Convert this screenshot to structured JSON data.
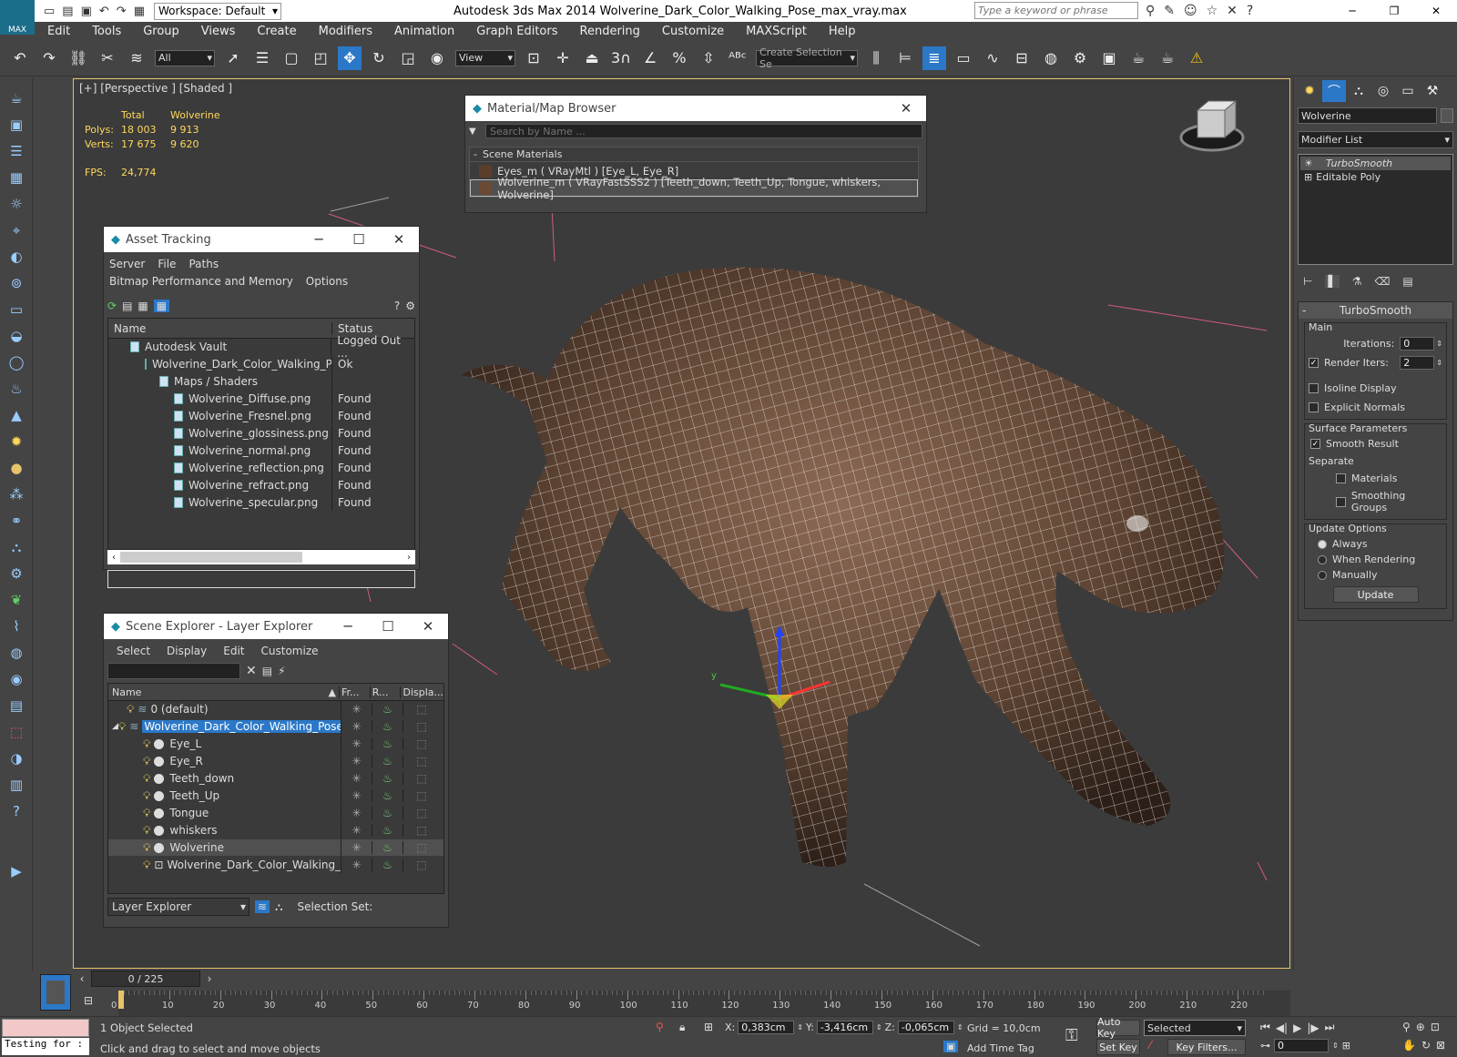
{
  "app": {
    "title": "Autodesk 3ds Max  2014    Wolverine_Dark_Color_Walking_Pose_max_vray.max",
    "logo": "MAX",
    "workspace": "Workspace: Default",
    "search_placeholder": "Type a keyword or phrase"
  },
  "menu": [
    "Edit",
    "Tools",
    "Group",
    "Views",
    "Create",
    "Modifiers",
    "Animation",
    "Graph Editors",
    "Rendering",
    "Customize",
    "MAXScript",
    "Help"
  ],
  "toolbar": {
    "filter": "All",
    "view": "View",
    "snap_label": "3",
    "create_selection": "Create Selection Se"
  },
  "viewport": {
    "label": "[+] [Perspective ] [Shaded ]",
    "stats": {
      "col_total": "Total",
      "col_object": "Wolverine",
      "polys_label": "Polys:",
      "polys_total": "18 003",
      "polys_obj": "9 913",
      "verts_label": "Verts:",
      "verts_total": "17 675",
      "verts_obj": "9 620",
      "fps_label": "FPS:",
      "fps": "24,774"
    }
  },
  "material_browser": {
    "title": "Material/Map Browser",
    "search_placeholder": "Search by Name ...",
    "group": "Scene Materials",
    "items": [
      "Eyes_m  ( VRayMtl )  [Eye_L, Eye_R]",
      "Wolverine_m  ( VRayFastSSS2 )  [Teeth_down, Teeth_Up, Tongue, whiskers, Wolverine]"
    ]
  },
  "asset_tracking": {
    "title": "Asset Tracking",
    "menu": [
      "Server",
      "File",
      "Paths",
      "Bitmap Performance and Memory",
      "Options"
    ],
    "col_name": "Name",
    "col_status": "Status",
    "rows": [
      {
        "name": "Autodesk Vault",
        "status": "Logged Out ..."
      },
      {
        "name": "Wolverine_Dark_Color_Walking_Po...",
        "status": "Ok"
      },
      {
        "name": "Maps / Shaders",
        "status": ""
      },
      {
        "name": "Wolverine_Diffuse.png",
        "status": "Found"
      },
      {
        "name": "Wolverine_Fresnel.png",
        "status": "Found"
      },
      {
        "name": "Wolverine_glossiness.png",
        "status": "Found"
      },
      {
        "name": "Wolverine_normal.png",
        "status": "Found"
      },
      {
        "name": "Wolverine_reflection.png",
        "status": "Found"
      },
      {
        "name": "Wolverine_refract.png",
        "status": "Found"
      },
      {
        "name": "Wolverine_specular.png",
        "status": "Found"
      }
    ]
  },
  "scene_explorer": {
    "title": "Scene Explorer - Layer Explorer",
    "menu": [
      "Select",
      "Display",
      "Edit",
      "Customize"
    ],
    "columns": [
      "Name",
      "Fr...",
      "R...",
      "Displa..."
    ],
    "rows": [
      {
        "name": "0 (default)",
        "indent": 0,
        "type": "layer"
      },
      {
        "name": "Wolverine_Dark_Color_Walking_Pose",
        "indent": 0,
        "type": "layer",
        "selected": true
      },
      {
        "name": "Eye_L",
        "indent": 1,
        "type": "obj"
      },
      {
        "name": "Eye_R",
        "indent": 1,
        "type": "obj"
      },
      {
        "name": "Teeth_down",
        "indent": 1,
        "type": "obj"
      },
      {
        "name": "Teeth_Up",
        "indent": 1,
        "type": "obj"
      },
      {
        "name": "Tongue",
        "indent": 1,
        "type": "obj"
      },
      {
        "name": "whiskers",
        "indent": 1,
        "type": "obj"
      },
      {
        "name": "Wolverine",
        "indent": 1,
        "type": "obj",
        "highlight": true
      },
      {
        "name": "Wolverine_Dark_Color_Walking_Pose",
        "indent": 1,
        "type": "group"
      }
    ],
    "footer_mode": "Layer Explorer",
    "selection_set": "Selection Set:"
  },
  "command_panel": {
    "object_name": "Wolverine",
    "modifier_list": "Modifier List",
    "stack": [
      "TurboSmooth",
      "Editable Poly"
    ],
    "rollout": "TurboSmooth",
    "main": "Main",
    "iterations_label": "Iterations:",
    "iterations": "0",
    "render_iters_label": "Render Iters:",
    "render_iters": "2",
    "isoline": "Isoline Display",
    "explicit_normals": "Explicit Normals",
    "surface_params": "Surface Parameters",
    "smooth_result": "Smooth Result",
    "separate": "Separate",
    "materials": "Materials",
    "smoothing_groups": "Smoothing Groups",
    "update_options": "Update Options",
    "always": "Always",
    "when_rendering": "When Rendering",
    "manually": "Manually",
    "update_btn": "Update"
  },
  "timeline": {
    "frame": "0 / 225",
    "ticks": [
      "0",
      "10",
      "20",
      "30",
      "40",
      "50",
      "60",
      "70",
      "80",
      "90",
      "100",
      "110",
      "120",
      "130",
      "140",
      "150",
      "160",
      "170",
      "180",
      "190",
      "200",
      "210",
      "220"
    ]
  },
  "status": {
    "script": "Testing for :",
    "selected": "1 Object Selected",
    "prompt": "Click and drag to select and move objects",
    "x_label": "X:",
    "x": "0,383cm",
    "y_label": "Y:",
    "y": "-3,416cm",
    "z_label": "Z:",
    "z": "-0,065cm",
    "grid": "Grid = 10,0cm",
    "auto_key": "Auto Key",
    "selected_mode": "Selected",
    "set_key": "Set Key",
    "key_filters": "Key Filters...",
    "add_time_tag": "Add Time Tag",
    "current_frame": "0"
  },
  "colors": {
    "accent": "#2b78c8",
    "viewport_border": "#e6c36c",
    "stats": "#ffd75c"
  }
}
